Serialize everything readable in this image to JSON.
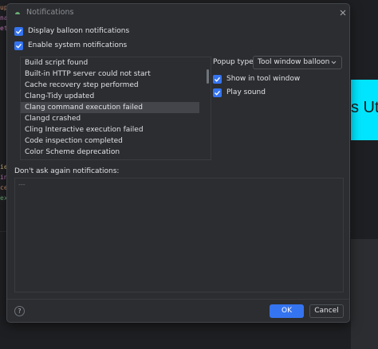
{
  "background": {
    "code_fragments": [
      {
        "text": "up",
        "color": "#cf8e6d"
      },
      {
        "text": "na",
        "color": "#c77dbb"
      },
      {
        "text": "et",
        "color": "#c77dbb"
      },
      {
        "text": "ie",
        "color": "#d5b778"
      },
      {
        "text": "in",
        "color": "#c77dbb"
      },
      {
        "text": "ce",
        "color": "#cf8e6d"
      },
      {
        "text": "ex",
        "color": "#6aab73"
      }
    ],
    "highlight_text": "s Utk",
    "highlight_color": "#00e5ff"
  },
  "dialog": {
    "title": "Notifications",
    "close_icon": "close-icon",
    "checkboxes": {
      "display_balloon": {
        "label": "Display balloon notifications",
        "checked": true
      },
      "enable_system": {
        "label": "Enable system notifications",
        "checked": true
      },
      "show_in_tool_window": {
        "label": "Show in tool window",
        "checked": true
      },
      "play_sound": {
        "label": "Play sound",
        "checked": true
      }
    },
    "notification_groups": [
      "Build script found",
      "Built-in HTTP server could not start",
      "Cache recovery step performed",
      "Clang-Tidy updated",
      "Clang command execution failed",
      "Clangd crashed",
      "Cling Interactive execution failed",
      "Code inspection completed",
      "Color Scheme deprecation"
    ],
    "selected_group": "Clang command execution failed",
    "popup_type": {
      "label": "Popup type:",
      "value": "Tool window balloon"
    },
    "dont_ask_label": "Don't ask again notifications:",
    "dont_ask_placeholder": "---",
    "buttons": {
      "help": "?",
      "ok": "OK",
      "cancel": "Cancel"
    },
    "accent_color": "#3574f0"
  }
}
